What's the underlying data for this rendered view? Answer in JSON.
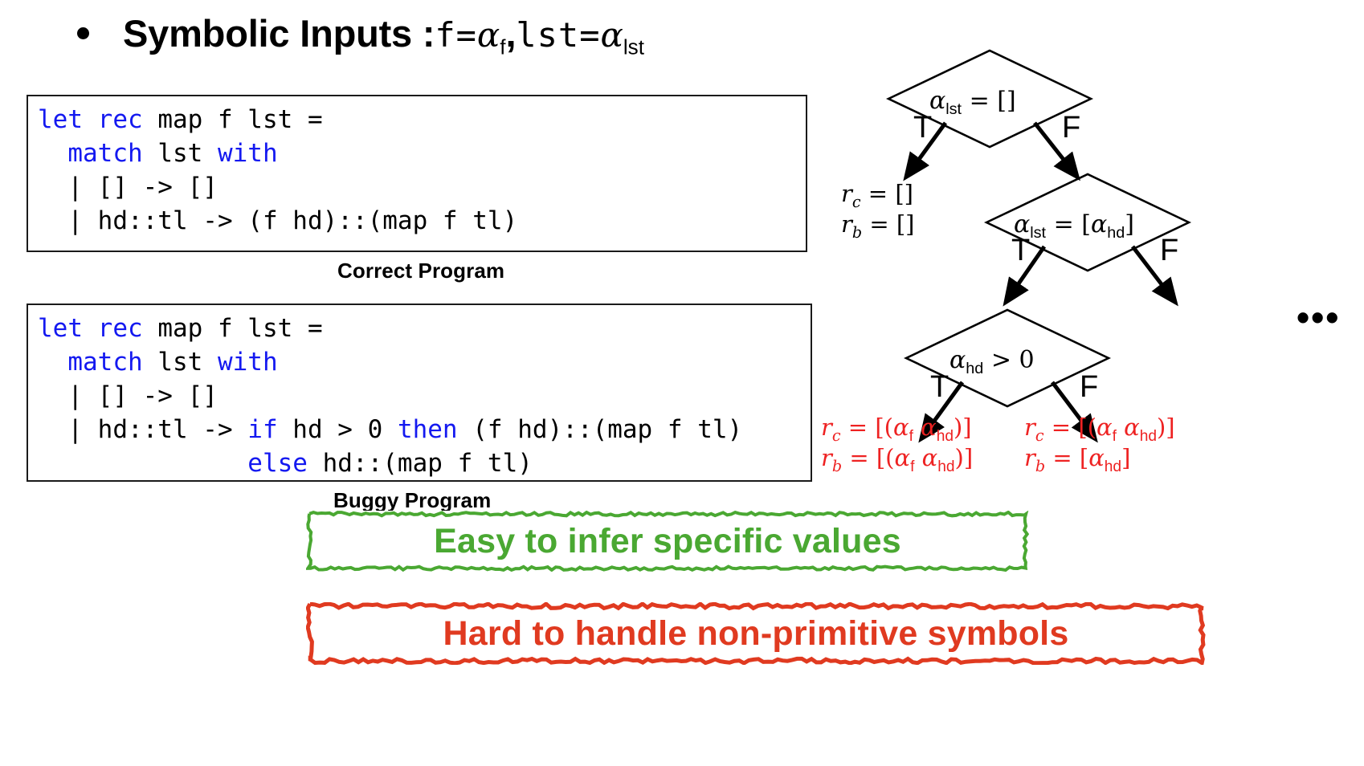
{
  "headline": {
    "bullet_glyph": "•",
    "prefix": "Symbolic Inputs : ",
    "f_var": "f=",
    "f_symbol": "α",
    "f_subscript": "f",
    "comma": " , ",
    "lst_var": "lst=",
    "lst_symbol": "α",
    "lst_subscript": "lst"
  },
  "correct_program": {
    "caption": "Correct Program",
    "lines": [
      [
        {
          "t": "let rec",
          "kw": true
        },
        {
          "t": " map f lst =",
          "kw": false
        }
      ],
      [
        {
          "t": "  ",
          "kw": false
        },
        {
          "t": "match",
          "kw": true
        },
        {
          "t": " lst ",
          "kw": false
        },
        {
          "t": "with",
          "kw": true
        }
      ],
      [
        {
          "t": "  | [] -> []",
          "kw": false
        }
      ],
      [
        {
          "t": "  | hd::tl -> (f hd)::(map f tl)",
          "kw": false
        }
      ]
    ]
  },
  "buggy_program": {
    "caption": "Buggy Program",
    "lines": [
      [
        {
          "t": "let rec",
          "kw": true
        },
        {
          "t": " map f lst =",
          "kw": false
        }
      ],
      [
        {
          "t": "  ",
          "kw": false
        },
        {
          "t": "match",
          "kw": true
        },
        {
          "t": " lst ",
          "kw": false
        },
        {
          "t": "with",
          "kw": true
        }
      ],
      [
        {
          "t": "  | [] -> []",
          "kw": false
        }
      ],
      [
        {
          "t": "  | hd::tl -> ",
          "kw": false
        },
        {
          "t": "if",
          "kw": true
        },
        {
          "t": " hd > 0 ",
          "kw": false
        },
        {
          "t": "then",
          "kw": true
        },
        {
          "t": " (f hd)::(map f tl)",
          "kw": false
        }
      ],
      [
        {
          "t": "              ",
          "kw": false
        },
        {
          "t": "else",
          "kw": true
        },
        {
          "t": " hd::(map f tl)",
          "kw": false
        }
      ]
    ]
  },
  "tree": {
    "node1_condition_symbol": "α",
    "node1_condition_sub": "lst",
    "node1_condition_rest": " = []",
    "node2_condition_symbol": "α",
    "node2_condition_sub": "lst",
    "node2_condition_rest": " = [",
    "node2_condition_symbol2": "α",
    "node2_condition_sub2": "hd",
    "node2_condition_close": "]",
    "node3_condition_symbol": "α",
    "node3_condition_sub": "hd",
    "node3_condition_rest": " > 0",
    "true_label": "T",
    "false_label": "F",
    "ellipsis": "•••",
    "leaf1": {
      "rc_var": "r",
      "rc_sub": "c",
      "rc_value": " = []",
      "rb_var": "r",
      "rb_sub": "b",
      "rb_value": " = []"
    },
    "leaf2": {
      "rc_var": "r",
      "rc_sub": "c",
      "rc_value_pre": " = [(",
      "rc_alpha1": "α",
      "rc_alpha1_sub": "f",
      "rc_space": " ",
      "rc_alpha2": "α",
      "rc_alpha2_sub": "hd",
      "rc_value_post": ")]",
      "rb_var": "r",
      "rb_sub": "b",
      "rb_value_pre": " = [(",
      "rb_alpha1": "α",
      "rb_alpha1_sub": "f",
      "rb_space": " ",
      "rb_alpha2": "α",
      "rb_alpha2_sub": "hd",
      "rb_value_post": ")]"
    },
    "leaf3": {
      "rc_var": "r",
      "rc_sub": "c",
      "rc_value_pre": " = [(",
      "rc_alpha1": "α",
      "rc_alpha1_sub": "f",
      "rc_space": " ",
      "rc_alpha2": "α",
      "rc_alpha2_sub": "hd",
      "rc_value_post": ")]",
      "rb_var": "r",
      "rb_sub": "b",
      "rb_value_pre": " = [",
      "rb_alpha1": "α",
      "rb_alpha1_sub": "hd",
      "rb_value_post": "]"
    }
  },
  "callouts": {
    "green_text": "Easy to infer specific values",
    "green_color": "#4aa832",
    "red_text": "Hard to handle non-primitive symbols",
    "red_color": "#e03a20"
  },
  "colors": {
    "keyword_blue": "#1419f0",
    "result_red": "#ee2222",
    "border_black": "#1a1a1a"
  }
}
